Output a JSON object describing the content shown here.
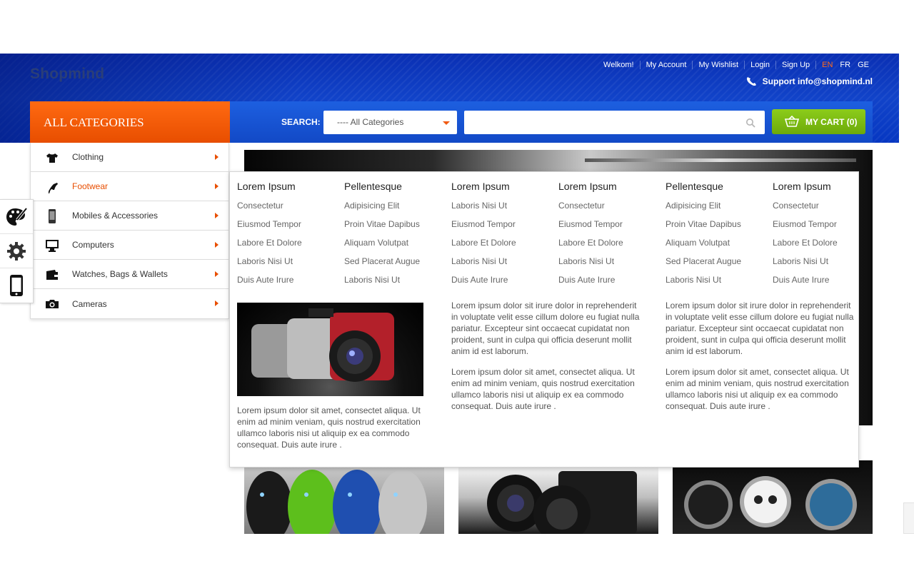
{
  "header": {
    "logo": "Shopmind",
    "top_links": [
      "Welkom!",
      "My Account",
      "My Wishlist",
      "Login",
      "Sign Up"
    ],
    "languages": [
      "EN",
      "FR",
      "GE"
    ],
    "active_language": "EN",
    "support": "Support info@shopmind.nl"
  },
  "nav": {
    "all_categories": "ALL CATEGORIES",
    "search_label": "SEARCH:",
    "category_select": "---- All Categories",
    "search_placeholder": "",
    "cart_label": "MY CART (0)"
  },
  "categories": [
    {
      "label": "Clothing",
      "icon": "tshirt-icon"
    },
    {
      "label": "Footwear",
      "icon": "high-heel-icon"
    },
    {
      "label": "Mobiles & Accessories",
      "icon": "mobile-phone-icon"
    },
    {
      "label": "Computers",
      "icon": "monitor-icon"
    },
    {
      "label": "Watches, Bags & Wallets",
      "icon": "wallet-icon"
    },
    {
      "label": "Cameras",
      "icon": "camera-icon"
    }
  ],
  "active_category": "Footwear",
  "mega_menu": {
    "columns": [
      {
        "title": "Lorem Ipsum",
        "links": [
          "Consectetur",
          "Eiusmod Tempor",
          "Labore Et Dolore",
          "Laboris Nisi Ut",
          "Duis Aute Irure"
        ]
      },
      {
        "title": "Pellentesque",
        "links": [
          "Adipisicing Elit",
          "Proin Vitae Dapibus",
          "Aliquam Volutpat",
          "Sed Placerat Augue",
          "Laboris Nisi Ut"
        ]
      },
      {
        "title": "Lorem Ipsum",
        "links": [
          "Laboris Nisi Ut",
          "Eiusmod Tempor",
          "Labore Et Dolore",
          "Laboris Nisi Ut",
          "Duis Aute Irure"
        ]
      },
      {
        "title": "Lorem Ipsum",
        "links": [
          "Consectetur",
          "Eiusmod Tempor",
          "Labore Et Dolore",
          "Laboris Nisi Ut",
          "Duis Aute Irure"
        ]
      },
      {
        "title": "Pellentesque",
        "links": [
          "Adipisicing Elit",
          "Proin Vitae Dapibus",
          "Aliquam Volutpat",
          "Sed Placerat Augue",
          "Laboris Nisi Ut"
        ]
      },
      {
        "title": "Lorem Ipsum",
        "links": [
          "Consectetur",
          "Eiusmod Tempor",
          "Labore Et Dolore",
          "Laboris Nisi Ut",
          "Duis Aute Irure"
        ]
      }
    ],
    "image_caption": "Lorem ipsum dolor sit amet, consectet aliqua. Ut enim ad minim veniam, quis nostrud exercitation ullamco laboris nisi ut aliquip ex ea commodo consequat. Duis aute irure .",
    "text_a": "Lorem ipsum dolor sit irure dolor in reprehenderit in voluptate velit esse cillum dolore eu fugiat nulla pariatur. Excepteur sint occaecat cupidatat non proident, sunt in culpa qui officia deserunt mollit anim id est laborum.",
    "text_b": "Lorem ipsum dolor sit amet, consectet aliqua. Ut enim ad minim veniam, quis nostrud exercitation ullamco laboris nisi ut aliquip ex ea commodo consequat. Duis aute irure .",
    "text_c": "Lorem ipsum dolor sit irure dolor in reprehenderit in voluptate velit esse cillum dolore eu fugiat nulla pariatur. Excepteur sint occaecat cupidatat non proident, sunt in culpa qui officia deserunt mollit anim id est laborum.",
    "text_d": "Lorem ipsum dolor sit amet, consectet aliqua. Ut enim ad minim veniam, quis nostrud exercitation ullamco laboris nisi ut aliquip ex ea commodo consequat. Duis aute irure ."
  },
  "side_tools": [
    "palette-icon",
    "gear-icon",
    "smartphone-icon"
  ],
  "colors": {
    "header_blue": "#0a2fb3",
    "accent_orange": "#e84e00",
    "cart_green": "#7bbb12"
  }
}
